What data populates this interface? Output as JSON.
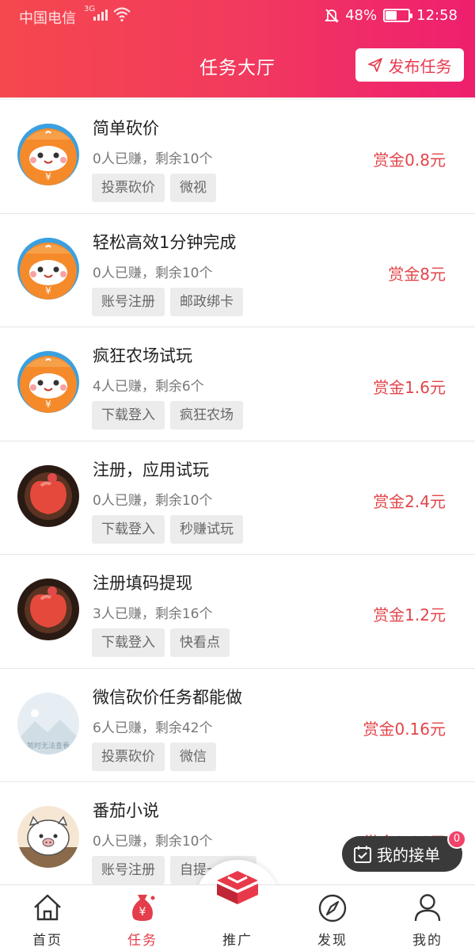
{
  "status_bar": {
    "carrier": "中国电信",
    "network": "3G",
    "battery_pct": "48%",
    "battery_level": 0.48,
    "time": "12:58"
  },
  "header": {
    "title": "任务大厅",
    "publish_label": "发布任务"
  },
  "tasks": [
    {
      "title": "简单砍价",
      "stats": "0人已赚，剩余10个",
      "tags": [
        "投票砍价",
        "微视"
      ],
      "reward": "赏金0.8元",
      "avatar": "orange-mascot-avatar"
    },
    {
      "title": "轻松高效1分钟完成",
      "stats": "0人已赚，剩余10个",
      "tags": [
        "账号注册",
        "邮政绑卡"
      ],
      "reward": "赏金8元",
      "avatar": "orange-mascot-avatar"
    },
    {
      "title": "疯狂农场试玩",
      "stats": "4人已赚，剩余6个",
      "tags": [
        "下载登入",
        "疯狂农场"
      ],
      "reward": "赏金1.6元",
      "avatar": "orange-mascot-avatar"
    },
    {
      "title": "注册，应用试玩",
      "stats": "0人已赚，剩余10个",
      "tags": [
        "下载登入",
        "秒赚试玩"
      ],
      "reward": "赏金2.4元",
      "avatar": "peach-avatar"
    },
    {
      "title": "注册填码提现",
      "stats": "3人已赚，剩余16个",
      "tags": [
        "下载登入",
        "快看点"
      ],
      "reward": "赏金1.2元",
      "avatar": "peach-avatar"
    },
    {
      "title": "微信砍价任务都能做",
      "stats": "6人已赚，剩余42个",
      "tags": [
        "投票砍价",
        "微信"
      ],
      "reward": "赏金0.16元",
      "avatar": "placeholder-avatar",
      "avatar_text": "暂时无法查看"
    },
    {
      "title": "番茄小说",
      "stats": "0人已赚，剩余10个",
      "tags": [
        "账号注册",
        "自提一块钱"
      ],
      "reward": "赏金0.96元",
      "avatar": "pig-avatar"
    }
  ],
  "floating": {
    "my_orders_label": "我的接单",
    "badge_count": "0"
  },
  "tabbar": {
    "items": [
      {
        "label": "首页",
        "icon": "home-icon"
      },
      {
        "label": "任务",
        "icon": "money-bag-icon"
      },
      {
        "label": "推广",
        "icon": "promote-icon"
      },
      {
        "label": "发现",
        "icon": "compass-icon"
      },
      {
        "label": "我的",
        "icon": "user-icon"
      }
    ],
    "active_index": 1
  },
  "colors": {
    "header_start": "#f5484e",
    "header_end": "#ee1f6f",
    "reward": "#e2454a",
    "active_tab": "#e43d4b"
  }
}
